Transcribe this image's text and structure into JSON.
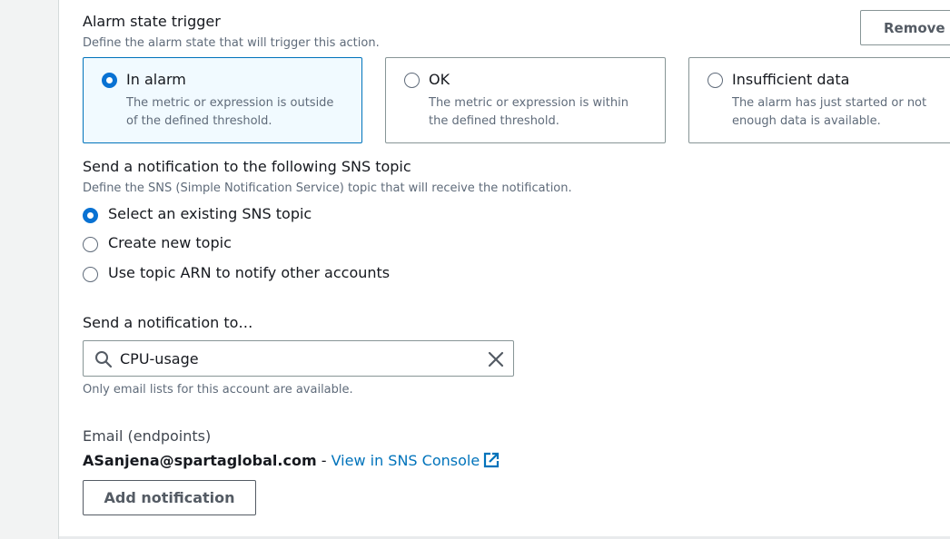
{
  "alarm_state": {
    "heading": "Alarm state trigger",
    "description": "Define the alarm state that will trigger this action.",
    "remove_label": "Remove",
    "options": [
      {
        "label": "In alarm",
        "desc1": "The metric or expression is outside",
        "desc2": "of the defined threshold.",
        "selected": true
      },
      {
        "label": "OK",
        "desc1": "The metric or expression is within",
        "desc2": "the defined threshold.",
        "selected": false
      },
      {
        "label": "Insufficient data",
        "desc1": "The alarm has just started or not",
        "desc2": "enough data is available.",
        "selected": false
      }
    ]
  },
  "sns_topic": {
    "heading": "Send a notification to the following SNS topic",
    "description": "Define the SNS (Simple Notification Service) topic that will receive the notification.",
    "options": [
      {
        "label": "Select an existing SNS topic",
        "selected": true
      },
      {
        "label": "Create new topic",
        "selected": false
      },
      {
        "label": "Use topic ARN to notify other accounts",
        "selected": false
      }
    ]
  },
  "send_to": {
    "label": "Send a notification to…",
    "value": "CPU-usage",
    "hint": "Only email lists for this account are available."
  },
  "endpoints": {
    "label": "Email (endpoints)",
    "email": "ASanjena@spartaglobal.com",
    "separator": " - ",
    "link_label": "View in SNS Console"
  },
  "add_notification_label": "Add notification",
  "colors": {
    "accent": "#0972d3",
    "link": "#0073bb",
    "selected_tile_bg": "#f1faff"
  }
}
